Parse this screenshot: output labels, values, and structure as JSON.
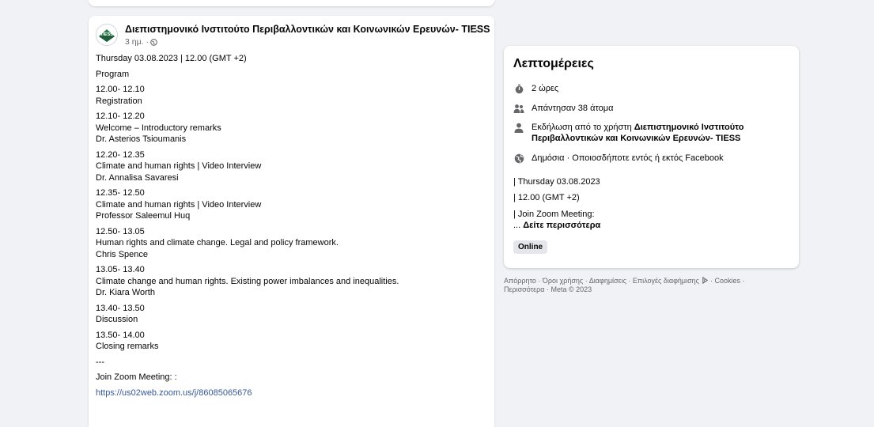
{
  "post": {
    "page_name": "Διεπιστημονικό Ινστιτούτο Περιβαλλοντικών και Κοινωνικών Ερευνών- TIESS",
    "avatar_text": "TIESS",
    "time": "3 ημ. ·",
    "more_label": "···",
    "lines": [
      {
        "text": "Thursday 03.08.2023  | 12.00 (GMT +2)",
        "gap": 0
      },
      {
        "text": "Program",
        "gap": 5
      },
      {
        "text": "12.00- 12.10",
        "gap": 5
      },
      {
        "text": "Registration",
        "gap": 0
      },
      {
        "text": "12.10- 12.20",
        "gap": 5
      },
      {
        "text": "Welcome – Introductory remarks",
        "gap": 0
      },
      {
        "text": "Dr. Asterios Tsioumanis",
        "gap": 0
      },
      {
        "text": "12.20- 12.35",
        "gap": 5
      },
      {
        "text": "Climate and human rights | Video Interview",
        "gap": 0
      },
      {
        "text": "Dr. Annalisa Savaresi",
        "gap": 0
      },
      {
        "text": "12.35- 12.50",
        "gap": 5
      },
      {
        "text": "Climate and human rights | Video Interview",
        "gap": 0
      },
      {
        "text": "Professor Saleemul Huq",
        "gap": 0
      },
      {
        "text": "12.50- 13.05",
        "gap": 5
      },
      {
        "text": "Human rights and climate change. Legal and policy framework.",
        "gap": 0
      },
      {
        "text": "Chris Spence",
        "gap": 0
      },
      {
        "text": "13.05- 13.40",
        "gap": 5
      },
      {
        "text": "Climate change and human rights. Existing power imbalances and inequalities.",
        "gap": 0
      },
      {
        "text": "Dr. Kiara Worth",
        "gap": 0
      },
      {
        "text": "13.40- 13.50",
        "gap": 5
      },
      {
        "text": "Discussion",
        "gap": 0
      },
      {
        "text": "13.50- 14.00",
        "gap": 5
      },
      {
        "text": "Closing remarks",
        "gap": 0
      },
      {
        "text": "---",
        "gap": 5
      },
      {
        "text": " Join Zoom Meeting: :",
        "gap": 5
      }
    ],
    "zoom_link": "https://us02web.zoom.us/j/86085065676"
  },
  "details": {
    "title": "Λεπτομέρειες",
    "duration": "2 ώρες",
    "responses": "Απάντησαν 38 άτομα",
    "host_prefix": "Εκδήλωση από το χρήστη ",
    "host_name": "Διεπιστημονικό Ινστιτούτο Περιβαλλοντικών και Κοινωνικών Ερευνών- TIESS",
    "privacy": "Δημόσια · Οποιοσδήποτε εντός ή εκτός Facebook",
    "date_line": "| Thursday 03.08.2023",
    "time_line": "| 12.00 (GMT +2)",
    "zoom_line": "| Join Zoom Meeting:",
    "see_more_prefix": "... ",
    "see_more": "Δείτε περισσότερα",
    "badge": "Online"
  },
  "footer": {
    "privacy": "Απόρρητο",
    "terms": "Όροι χρήσης",
    "ads": "Διαφημίσεις",
    "ad_choices": "Επιλογές διαφήμισης",
    "cookies": "Cookies",
    "more": "Περισσότερα",
    "meta": "Meta © 2023"
  },
  "colors": {
    "page_bg": "#f0f2f5",
    "link": "#385898",
    "secondary_text": "#65676b",
    "avatar_green": "#2e7d4f"
  },
  "icons": {
    "timer": "stopwatch-icon",
    "people": "people-icon",
    "host": "person-icon",
    "privacy": "globe-icon"
  }
}
